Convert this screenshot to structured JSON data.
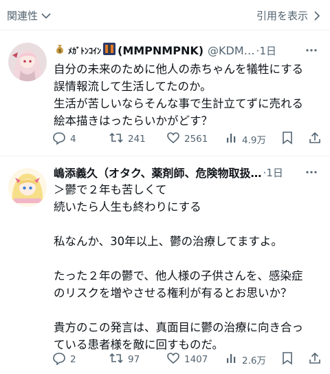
{
  "header": {
    "related_label": "関連性",
    "quote_link": "引用を表示"
  },
  "tweets": [
    {
      "name_suffix": "(MMPNMPNK)",
      "name_emoji_text": "ﾒｶﾞﾄﾝｺｲﾝ",
      "handle": "@KDM…",
      "time": "·1日",
      "text": "自分の未来のために他人の赤ちゃんを犠牲にする\n誤情報流して生活してたのか。\n生活が苦しいならそんな事で生計立てずに売れる\n絵本描きはったらいかがどす？",
      "replies": "4",
      "retweets": "241",
      "likes": "2561",
      "views": "4.9万"
    },
    {
      "name": "嶋添義久（オタク、薬剤師、危険物取扱…",
      "time": "·1日",
      "text": "＞鬱で２年も苦しくて\n続いたら人生も終わりにする\n\n私なんか、30年以上、鬱の治療してますよ。\n\nたった２年の鬱で、他人様の子供さんを、感染症\nのリスクを増やさせる権利が有るとお思いか？\n\n貴方のこの発言は、真面目に鬱の治療に向き合っ\nている患者様を敵に回すものだ。",
      "replies": "2",
      "retweets": "97",
      "likes": "1407",
      "views": "2.6万"
    }
  ],
  "colors": {
    "text": "#0f1419",
    "muted": "#536471",
    "divider": "#eff3f4"
  }
}
